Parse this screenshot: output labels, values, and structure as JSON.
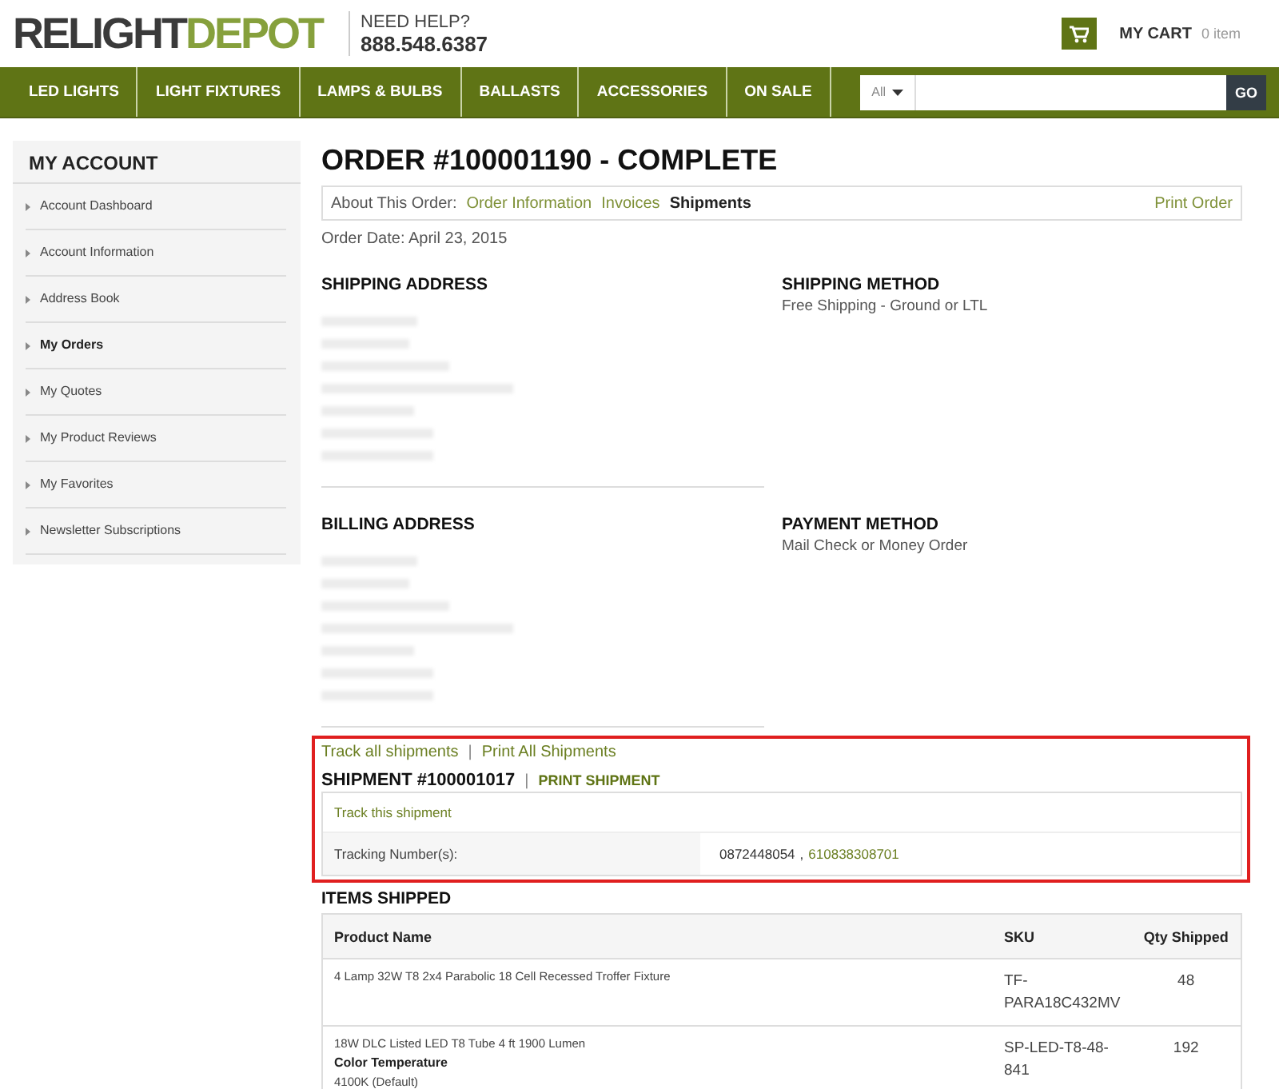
{
  "header": {
    "logo": {
      "dark": "RELIGHT",
      "green": "DEPOT"
    },
    "help_label": "NEED HELP?",
    "phone": "888.548.6387",
    "cart": {
      "label": "MY CART",
      "count": "0 item"
    }
  },
  "nav": {
    "items": [
      "LED LIGHTS",
      "LIGHT FIXTURES",
      "LAMPS & BULBS",
      "BALLASTS",
      "ACCESSORIES",
      "ON SALE"
    ],
    "search": {
      "category": "All",
      "button": "GO"
    }
  },
  "sidebar": {
    "title": "MY ACCOUNT",
    "items": [
      {
        "label": "Account Dashboard",
        "selected": false
      },
      {
        "label": "Account Information",
        "selected": false
      },
      {
        "label": "Address Book",
        "selected": false
      },
      {
        "label": "My Orders",
        "selected": true
      },
      {
        "label": "My Quotes",
        "selected": false
      },
      {
        "label": "My Product Reviews",
        "selected": false
      },
      {
        "label": "My Favorites",
        "selected": false
      },
      {
        "label": "Newsletter Subscriptions",
        "selected": false
      }
    ]
  },
  "order": {
    "title": "ORDER #100001190 - COMPLETE",
    "tabs_label": "About This Order:",
    "tabs": [
      {
        "label": "Order Information",
        "selected": false
      },
      {
        "label": "Invoices",
        "selected": false
      },
      {
        "label": "Shipments",
        "selected": true
      }
    ],
    "print": "Print Order",
    "date": "Order Date: April 23, 2015",
    "shipping_address": {
      "heading": "SHIPPING ADDRESS",
      "redacted": true
    },
    "shipping_method": {
      "heading": "SHIPPING METHOD",
      "value": "Free Shipping - Ground or LTL"
    },
    "billing_address": {
      "heading": "BILLING ADDRESS",
      "redacted": true
    },
    "payment_method": {
      "heading": "PAYMENT METHOD",
      "value": "Mail Check or Money Order"
    }
  },
  "shipments": {
    "highlighted": true,
    "track_all": "Track all shipments",
    "separator": "|",
    "print_all": "Print All Shipments",
    "title": "SHIPMENT #100001017",
    "title_separator": "|",
    "print": "PRINT SHIPMENT",
    "track": "Track this shipment",
    "tracking_label": "Tracking Number(s):",
    "tracking_numbers": [
      {
        "value": "0872448054",
        "kind": "plain"
      },
      {
        "value": "610838308701",
        "kind": "link"
      }
    ],
    "tracking_separator": ","
  },
  "items": {
    "heading": "ITEMS SHIPPED",
    "columns": [
      "Product Name",
      "SKU",
      "Qty Shipped"
    ],
    "rows": [
      {
        "name": "4 Lamp 32W T8 2x4 Parabolic 18 Cell Recessed Troffer Fixture",
        "option_label": null,
        "option_value": null,
        "sku": "TF-PARA18C432MV",
        "qty": "48"
      },
      {
        "name": "18W DLC Listed LED T8 Tube 4 ft 1900 Lumen",
        "option_label": "Color Temperature",
        "option_value": "4100K (Default)",
        "sku": "SP-LED-T8-48-841",
        "qty": "192"
      }
    ]
  }
}
